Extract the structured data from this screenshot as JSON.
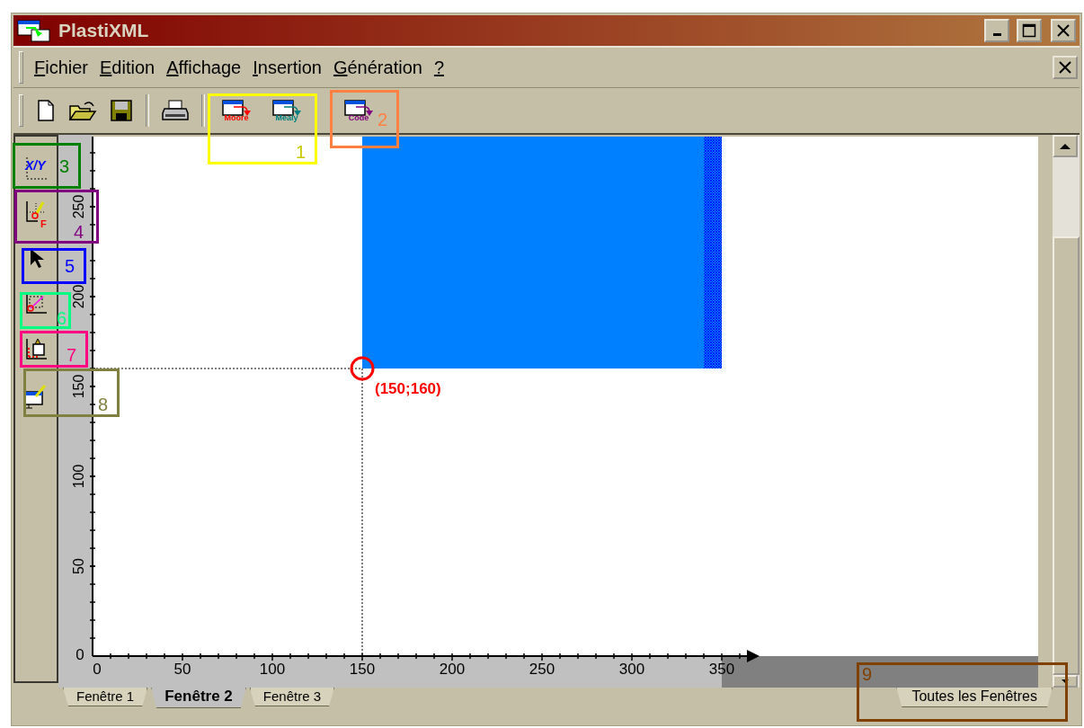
{
  "window": {
    "title": "PlastiXML"
  },
  "menu": [
    {
      "label": "Fichier"
    },
    {
      "label": "Edition"
    },
    {
      "label": "Affichage"
    },
    {
      "label": "Insertion"
    },
    {
      "label": "Génération"
    },
    {
      "label": "?"
    }
  ],
  "toolbar": [
    {
      "kind": "new"
    },
    {
      "kind": "open"
    },
    {
      "kind": "save"
    },
    {
      "kind": "print"
    },
    {
      "kind": "moore",
      "label": "Moore",
      "color": "#ff0000"
    },
    {
      "kind": "mealy",
      "label": "Mealy",
      "color": "#008080"
    },
    {
      "kind": "code",
      "label": "Code",
      "color": "#800080"
    }
  ],
  "left_tools": [
    {
      "kind": "axes",
      "label": "X/Y"
    },
    {
      "kind": "function",
      "label": "F"
    },
    {
      "kind": "pointer"
    },
    {
      "kind": "vector"
    },
    {
      "kind": "paint"
    },
    {
      "kind": "edit"
    }
  ],
  "canvas": {
    "x_labels": [
      "0",
      "50",
      "100",
      "150",
      "200",
      "250",
      "300",
      "350"
    ],
    "y_labels": [
      "0",
      "50",
      "100",
      "150",
      "200",
      "250"
    ],
    "point_label": "(150;160)"
  },
  "tabs": [
    {
      "label": "Fenêtre 1",
      "selected": false
    },
    {
      "label": "Fenêtre 2",
      "selected": true
    },
    {
      "label": "Fenêtre 3",
      "selected": false
    }
  ],
  "all_windows_tab": {
    "label": "Toutes les Fenêtres"
  },
  "annotations": [
    {
      "label": "1",
      "color": "#ffff00"
    },
    {
      "label": "2",
      "color": "#ff8040"
    },
    {
      "label": "3",
      "color": "#008000"
    },
    {
      "label": "4",
      "color": "#800080"
    },
    {
      "label": "5",
      "color": "#0000ff"
    },
    {
      "label": "6",
      "color": "#00ff80"
    },
    {
      "label": "7",
      "color": "#ff0080"
    },
    {
      "label": "8",
      "color": "#808040"
    },
    {
      "label": "9",
      "color": "#804000"
    }
  ]
}
